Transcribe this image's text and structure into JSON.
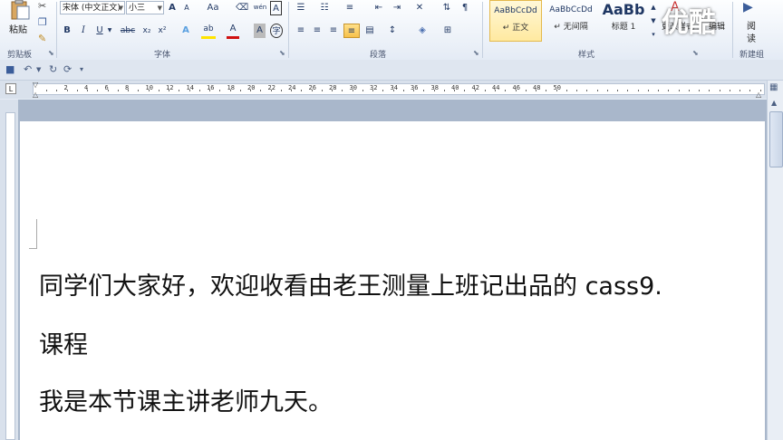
{
  "ribbon": {
    "clipboard": {
      "paste_label": "粘贴",
      "group_label": "剪贴板"
    },
    "font": {
      "font_name": "宋体 (中文正文)",
      "font_size": "小三",
      "grow_font": "A",
      "shrink_font": "A",
      "change_case": "Aa",
      "phonetic_guide": "wén",
      "char_border": "A",
      "bold": "B",
      "italic": "I",
      "underline": "U",
      "strikethrough": "abc",
      "subscript": "x₂",
      "superscript": "x²",
      "text_effects": "A",
      "highlight": "ab",
      "font_color": "A",
      "char_shading": "A",
      "enclose_char": "字",
      "group_label": "字体"
    },
    "paragraph": {
      "group_label": "段落"
    },
    "styles": {
      "items": [
        {
          "preview": "AaBbCcDd",
          "name": "↵ 正文"
        },
        {
          "preview": "AaBbCcDd",
          "name": "↵ 无间隔"
        },
        {
          "preview": "AaBb",
          "name": "标题 1"
        }
      ],
      "change_styles": "更改样式",
      "group_label": "样式"
    },
    "editing": {
      "label": "编辑"
    },
    "new_group": {
      "reading_top": "阅",
      "reading_bottom": "读",
      "group_label": "新建组"
    }
  },
  "watermark": "优酷",
  "ruler": {
    "numbers": [
      "2",
      "4",
      "6",
      "8",
      "10",
      "12",
      "14",
      "16",
      "18",
      "20",
      "22",
      "24",
      "26",
      "28",
      "30",
      "32",
      "34",
      "36",
      "38",
      "40",
      "42",
      "44",
      "46",
      "48",
      "50"
    ]
  },
  "document": {
    "lines": [
      "同学们大家好，欢迎收看由老王测量上班记出品的 cass9.",
      "课程",
      "我是本节课主讲老师九天。"
    ]
  },
  "colors": {
    "ribbon_bg": "#e4ebf5",
    "highlight_yellow": "#ffe400",
    "font_red": "#d01010",
    "selected_button": "#f7c14a"
  }
}
